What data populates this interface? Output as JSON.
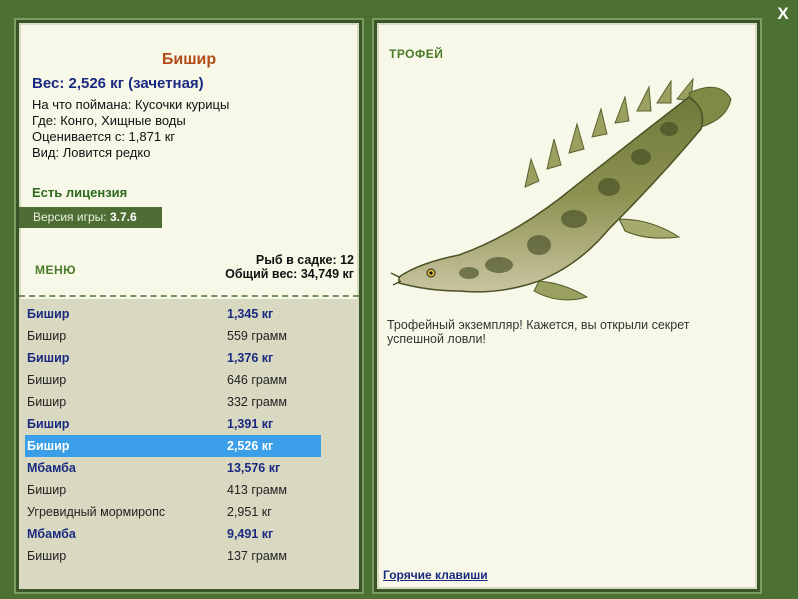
{
  "close_label": "X",
  "fish": {
    "title": "Бишир",
    "weight": "Вес: 2,526 кг (зачетная)",
    "caught_on": "На что поймана: Кусочки курицы",
    "location": "Где: Конго, Хищные воды",
    "valued_from": "Оценивается с: 1,871 кг",
    "rarity": "Вид: Ловится редко"
  },
  "license": "Есть лицензия",
  "version": {
    "label": "Версия игры:",
    "value": "3.7.6"
  },
  "menu_label": "МЕНЮ",
  "keepnet": {
    "fish_count": "Рыб в садке: 12",
    "total_weight": "Общий вес: 34,749 кг"
  },
  "catches": [
    {
      "name": "Бишир",
      "weight": "1,345 кг",
      "trophy": true
    },
    {
      "name": "Бишир",
      "weight": "559 грамм",
      "trophy": false
    },
    {
      "name": "Бишир",
      "weight": "1,376 кг",
      "trophy": true
    },
    {
      "name": "Бишир",
      "weight": "646 грамм",
      "trophy": false
    },
    {
      "name": "Бишир",
      "weight": "332 грамм",
      "trophy": false
    },
    {
      "name": "Бишир",
      "weight": "1,391 кг",
      "trophy": true
    },
    {
      "name": "Бишир",
      "weight": "2,526 кг",
      "trophy": true,
      "selected": true
    },
    {
      "name": "Мбамба",
      "weight": "13,576 кг",
      "trophy": true
    },
    {
      "name": "Бишир",
      "weight": "413 грамм",
      "trophy": false
    },
    {
      "name": "Угревидный мормиропс",
      "weight": "2,951 кг",
      "trophy": false
    },
    {
      "name": "Мбамба",
      "weight": "9,491 кг",
      "trophy": true
    },
    {
      "name": "Бишир",
      "weight": "137 грамм",
      "trophy": false
    }
  ],
  "trophy_header": "ТРОФЕЙ",
  "trophy_text": "Трофейный экземпляр! Кажется, вы открыли секрет успешной ловли!",
  "hotkeys_label": "Горячие клавиши",
  "colors": {
    "background": "#4d7133",
    "panel": "#f8f8e9",
    "list": "#d9d9c1",
    "selected": "#3a9ee8",
    "trophy_text": "#1a2a80",
    "title": "#b04a16"
  }
}
